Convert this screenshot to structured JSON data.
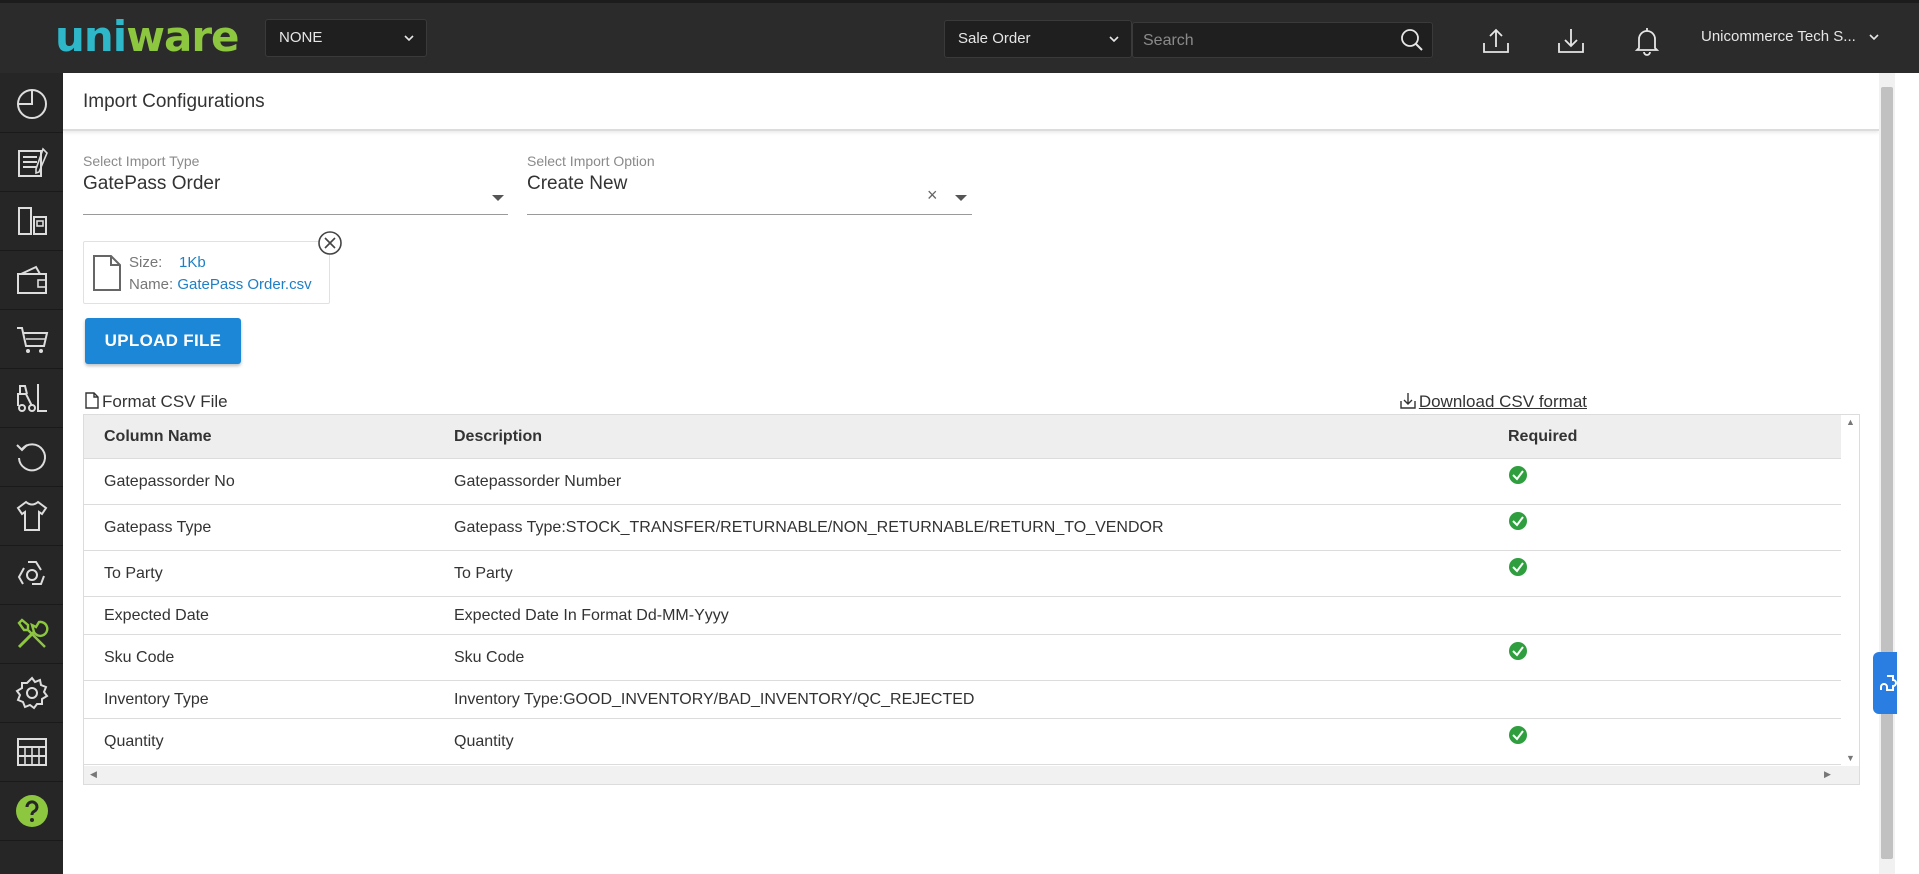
{
  "header": {
    "logo_part1": "uni",
    "logo_part2": "ware",
    "facility_select": "NONE",
    "search_type_select": "Sale Order",
    "search_placeholder": "Search",
    "account_name": "Unicommerce Tech S..."
  },
  "sidebar": {
    "items": [
      {
        "icon": "dashboard-icon"
      },
      {
        "icon": "orders-icon"
      },
      {
        "icon": "shipments-icon"
      },
      {
        "icon": "wallet-icon"
      },
      {
        "icon": "cart-icon"
      },
      {
        "icon": "forklift-icon"
      },
      {
        "icon": "returns-icon"
      },
      {
        "icon": "product-icon"
      },
      {
        "icon": "recycle-icon"
      },
      {
        "icon": "tools-icon",
        "active": true
      },
      {
        "icon": "settings-icon"
      },
      {
        "icon": "reports-icon"
      },
      {
        "icon": "help-icon"
      }
    ]
  },
  "page": {
    "title": "Import Configurations",
    "import_type_label": "Select Import Type",
    "import_type_value": "GatePass Order",
    "import_option_label": "Select Import Option",
    "import_option_value": "Create New",
    "file": {
      "size_label": "Size:",
      "size_value": "1Kb",
      "name_label": "Name:",
      "name_value": "GatePass Order.csv"
    },
    "upload_button": "UPLOAD FILE",
    "format_label": "Format CSV File",
    "download_link": "Download CSV format"
  },
  "table": {
    "headers": [
      "Column Name",
      "Description",
      "Required"
    ],
    "rows": [
      {
        "name": "Gatepassorder No",
        "description": "Gatepassorder Number",
        "required": true
      },
      {
        "name": "Gatepass Type",
        "description": "Gatepass Type:STOCK_TRANSFER/RETURNABLE/NON_RETURNABLE/RETURN_TO_VENDOR",
        "required": true
      },
      {
        "name": "To Party",
        "description": "To Party",
        "required": true
      },
      {
        "name": "Expected Date",
        "description": "Expected Date In Format Dd-MM-Yyyy",
        "required": false
      },
      {
        "name": "Sku Code",
        "description": "Sku Code",
        "required": true
      },
      {
        "name": "Inventory Type",
        "description": "Inventory Type:GOOD_INVENTORY/BAD_INVENTORY/QC_REJECTED",
        "required": false
      },
      {
        "name": "Quantity",
        "description": "Quantity",
        "required": true
      }
    ]
  },
  "colors": {
    "topbar": "#2b2b2b",
    "sidebar": "#262626",
    "accent": "#1b87d6",
    "check": "#2e9e3e",
    "active_icon": "#8dc63f"
  }
}
